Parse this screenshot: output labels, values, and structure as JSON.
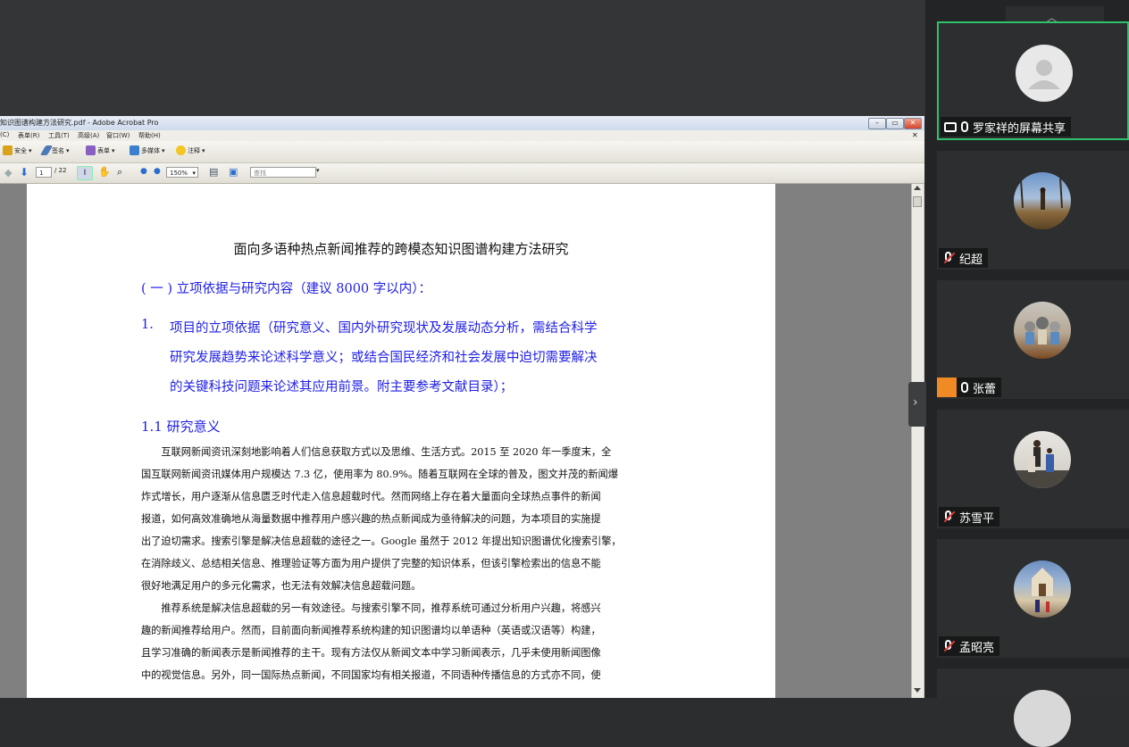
{
  "acrobat": {
    "title": "知识图谱构建方法研究.pdf - Adobe Acrobat Pro",
    "menu": [
      "(C)",
      "表单(R)",
      "工具(T)",
      "高级(A)",
      "窗口(W)",
      "帮助(H)"
    ],
    "toolbar1": [
      "安全",
      "签名",
      "表单",
      "多媒体",
      "注释"
    ],
    "page_current": "1",
    "page_total": "/ 22",
    "zoom": "150%",
    "find_placeholder": "查找"
  },
  "document": {
    "title": "面向多语种热点新闻推荐的跨模态知识图谱构建方法研究",
    "section": "( 一 )  立项依据与研究内容（建议 8000 字以内）：",
    "item_number": "1.",
    "item_lines": [
      "项目的立项依据（研究意义、国内外研究现状及发展动态分析，需结合科学",
      "研究发展趋势来论述科学意义；或结合国民经济和社会发展中迫切需要解决",
      "的关键科技问题来论述其应用前景。附主要参考文献目录）；"
    ],
    "subsection": "1.1 研究意义",
    "paragraph_lines": [
      "　　互联网新闻资讯深刻地影响着人们信息获取方式以及思维、生活方式。2015 至 2020 年一季度末，全",
      "国互联网新闻资讯媒体用户规模达 7.3 亿，使用率为 80.9%。随着互联网在全球的普及，图文并茂的新闻爆",
      "炸式增长，用户逐渐从信息匮乏时代走入信息超载时代。然而网络上存在着大量面向全球热点事件的新闻",
      "报道，如何高效准确地从海量数据中推荐用户感兴趣的热点新闻成为亟待解决的问题，为本项目的实施提",
      "出了迫切需求。搜索引擎是解决信息超载的途径之一。Google 虽然于 2012 年提出知识图谱优化搜索引擎，",
      "在消除歧义、总结相关信息、推理验证等方面为用户提供了完整的知识体系，但该引擎检索出的信息不能",
      "很好地满足用户的多元化需求，也无法有效解决信息超载问题。",
      "　　推荐系统是解决信息超载的另一有效途径。与搜索引擎不同，推荐系统可通过分析用户兴趣，将感兴",
      "趣的新闻推荐给用户。然而，目前面向新闻推荐系统构建的知识图谱均以单语种（英语或汉语等）构建，",
      "且学习准确的新闻表示是新闻推荐的主干。现有方法仅从新闻文本中学习新闻表示，几乎未使用新闻图像",
      "中的视觉信息。另外，同一国际热点新闻，不同国家均有相关报道，不同语种传播信息的方式亦不同，使"
    ]
  },
  "participants": [
    {
      "name": "罗家祥的屏幕共享",
      "status": "screen-share",
      "mic": "on",
      "active": true
    },
    {
      "name": "纪超",
      "status": "normal",
      "mic": "off",
      "active": false
    },
    {
      "name": "张蕾",
      "status": "host",
      "mic": "on",
      "active": false
    },
    {
      "name": "苏雪平",
      "status": "normal",
      "mic": "off",
      "active": false
    },
    {
      "name": "孟昭亮",
      "status": "normal",
      "mic": "off",
      "active": false
    }
  ]
}
